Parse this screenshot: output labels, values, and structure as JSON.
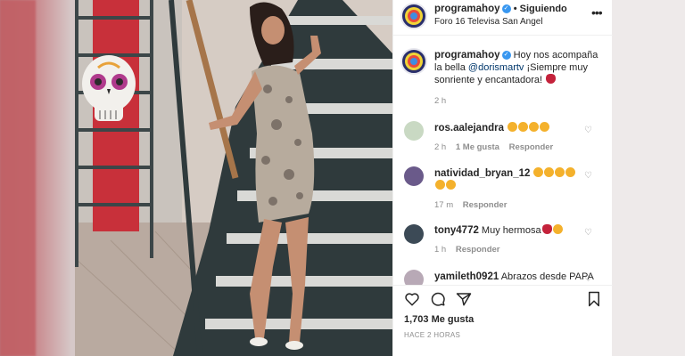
{
  "post": {
    "username": "programahoy",
    "follow_status": "• Siguiendo",
    "location": "Foro 16 Televisa San Angel",
    "caption": {
      "text_pre": "Hoy nos acompaña la bella ",
      "mention": "@dorismartv",
      "text_post": " ¡Siempre muy sonriente y encantadora!",
      "age": "2 h"
    },
    "comments": [
      {
        "user": "ros.aalejandra",
        "text": "",
        "emoji_count": 4,
        "age": "2 h",
        "likes": "1 Me gusta",
        "reply": "Responder",
        "avatar_color": "#c9d9c3"
      },
      {
        "user": "natividad_bryan_12",
        "text": "",
        "emoji_count": 6,
        "age": "17 m",
        "likes": "",
        "reply": "Responder",
        "avatar_color": "#6a5a8a"
      },
      {
        "user": "tony4772",
        "text": "Muy hermosa",
        "emoji_count": 2,
        "age": "1 h",
        "likes": "",
        "reply": "Responder",
        "avatar_color": "#3c4a56"
      },
      {
        "user": "yamileth0921",
        "text": "Abrazos desde PAPA",
        "emoji_count": 0,
        "age": "",
        "likes": "",
        "reply": "",
        "avatar_color": "#b8a9b6"
      }
    ],
    "likes": "1,703 Me gusta",
    "posted": "HACE 2 HORAS"
  },
  "icons": {
    "more": "more-dots-icon",
    "verified": "verified-badge-icon",
    "like": "heart-icon",
    "comment": "comment-icon",
    "share": "paper-plane-icon",
    "save": "bookmark-icon"
  },
  "colors": {
    "verified": "#3897f0",
    "muted": "#8e8e8e",
    "text": "#262626",
    "mention": "#00376b"
  }
}
